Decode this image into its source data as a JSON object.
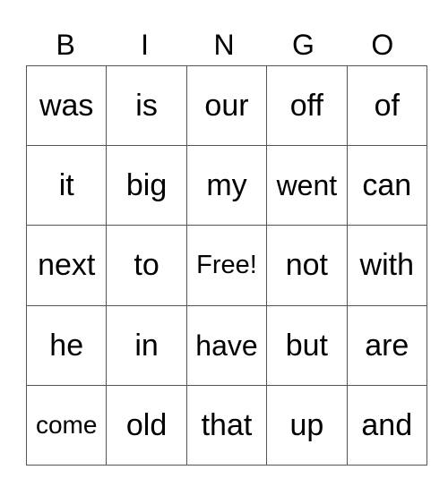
{
  "header": [
    "B",
    "I",
    "N",
    "G",
    "O"
  ],
  "rows": [
    [
      "was",
      "is",
      "our",
      "off",
      "of"
    ],
    [
      "it",
      "big",
      "my",
      "went",
      "can"
    ],
    [
      "next",
      "to",
      "Free!",
      "not",
      "with"
    ],
    [
      "he",
      "in",
      "have",
      "but",
      "are"
    ],
    [
      "come",
      "old",
      "that",
      "up",
      "and"
    ]
  ]
}
